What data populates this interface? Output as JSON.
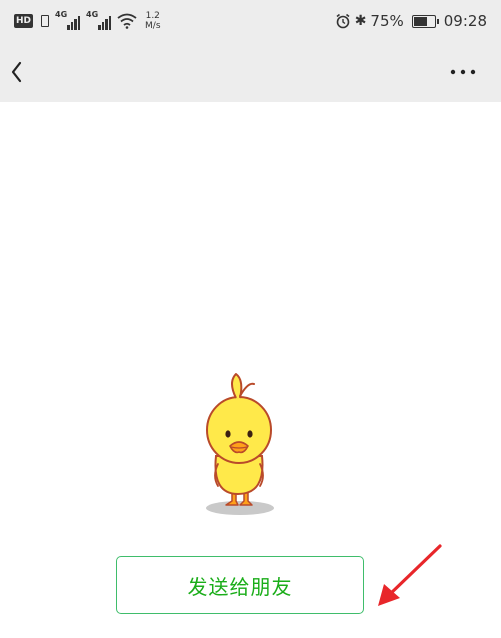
{
  "status_bar": {
    "hd_label": "HD",
    "signal_1_label": "4G",
    "signal_2_label": "4G",
    "speed_value": "1.2",
    "speed_unit": "M/s",
    "bluetooth_glyph": "✱",
    "battery_percent": "75%",
    "battery_level": 0.75,
    "time": "09:28"
  },
  "nav": {
    "back_icon": "chevron-left-icon",
    "more_icon": "more-horizontal-icon"
  },
  "sticker": {
    "icon": "yellow-chick-sticker",
    "colors": {
      "body": "#ffe94a",
      "outline": "#b94a2a",
      "beak": "#ffa11a",
      "shadow": "#c9c9c9"
    }
  },
  "actions": {
    "send_label": "发送给朋友",
    "accent_color": "#1aad19"
  },
  "annotation": {
    "arrow_icon": "red-arrow-icon",
    "color": "#e8262a"
  }
}
